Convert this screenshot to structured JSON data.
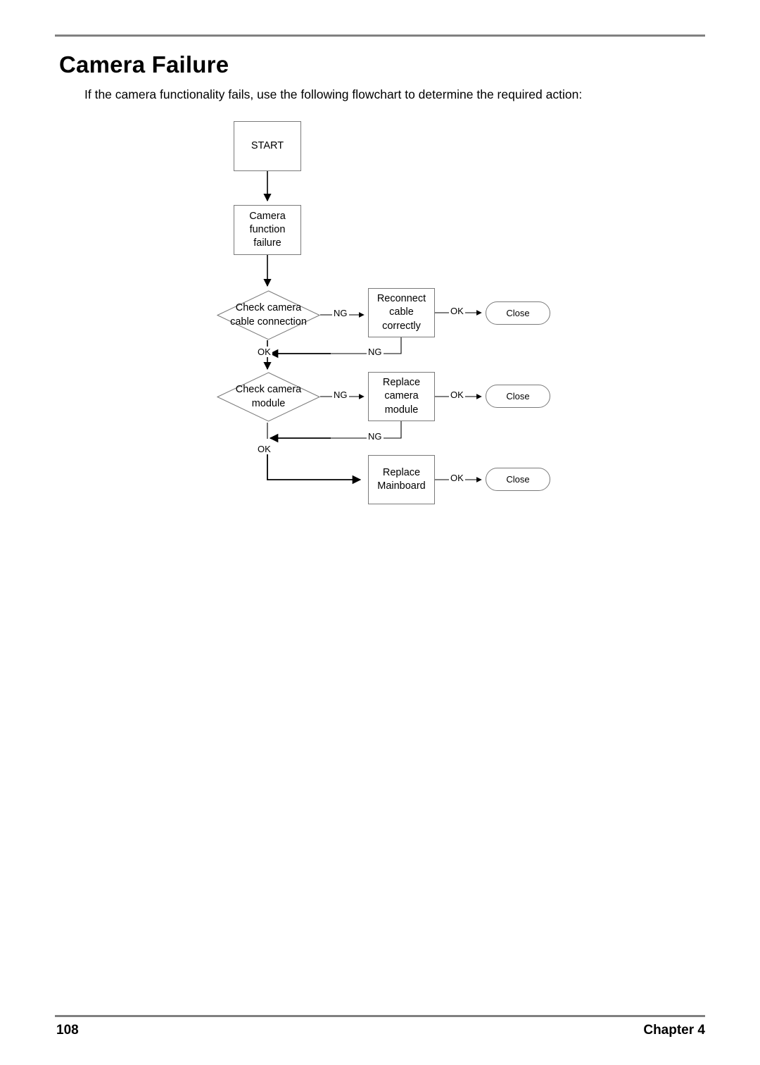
{
  "document": {
    "title": "Camera Failure",
    "intro": "If the camera functionality fails, use the following flowchart to determine the required action:"
  },
  "footer": {
    "page_number": "108",
    "chapter": "Chapter 4"
  },
  "flowchart": {
    "nodes": {
      "start": "START",
      "camera_function_failure": "Camera\nfunction failure",
      "camera_function_failure_line1": "Camera",
      "camera_function_failure_line2": "function failure",
      "check_cable_line1": "Check camera",
      "check_cable_line2": "cable connection",
      "reconnect_line1": "Reconnect",
      "reconnect_line2": "cable correctly",
      "close_1": "Close",
      "check_module_line1": "Check camera",
      "check_module_line2": "module",
      "replace_module_line1": "Replace",
      "replace_module_line2": "camera",
      "replace_module_line3": "module",
      "close_2": "Close",
      "replace_mainboard_line1": "Replace",
      "replace_mainboard_line2": "Mainboard",
      "close_3": "Close"
    },
    "edge_labels": {
      "ng_cable": "NG",
      "ok_reconnect": "OK",
      "ng_reconnect_loop": "NG",
      "ok_cable": "OK",
      "ng_module": "NG",
      "ok_replace_module": "OK",
      "ng_replace_module_loop": "NG",
      "ok_module": "OK",
      "ok_mainboard": "OK"
    },
    "colors": {
      "stroke": "#7a7a7a",
      "arrow": "#000000",
      "rule": "#808080"
    }
  }
}
